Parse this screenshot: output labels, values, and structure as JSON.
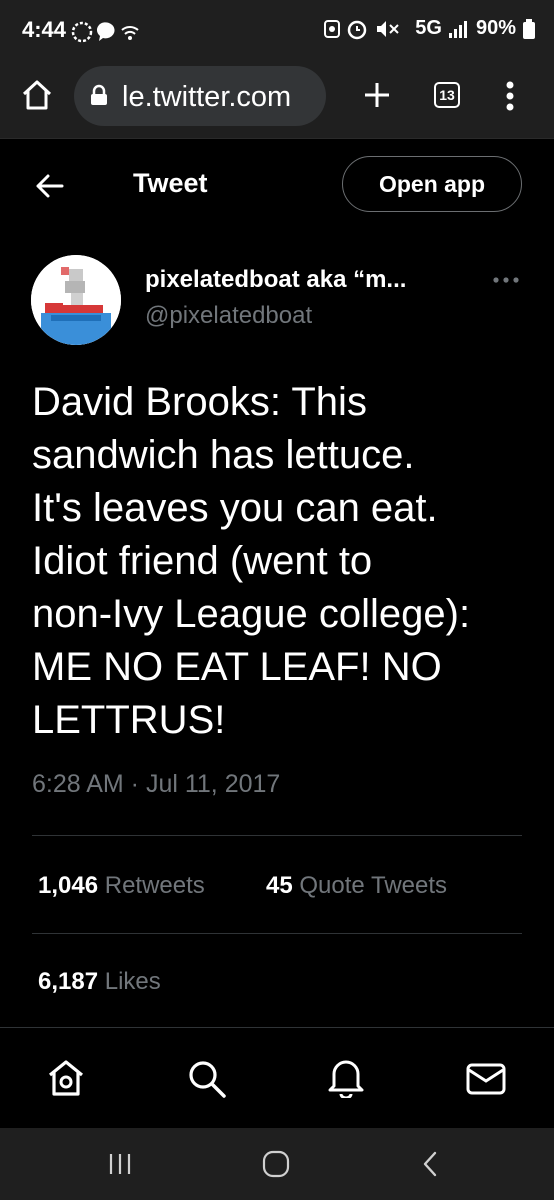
{
  "status_bar": {
    "time": "4:44",
    "network": "5G",
    "battery": "90%"
  },
  "browser": {
    "url": "le.twitter.com",
    "tab_count": "13"
  },
  "header": {
    "title": "Tweet",
    "open_app_label": "Open app"
  },
  "tweet": {
    "display_name": "pixelatedboat aka “m...",
    "handle": "@pixelatedboat",
    "text": "David Brooks: This\nsandwich has lettuce.\nIt's leaves you can eat.\nIdiot friend (went to\nnon-Ivy League college):\nME NO EAT LEAF! NO\nLETTRUS!",
    "timestamp": "6:28 AM · Jul 11, 2017",
    "retweets_count": "1,046",
    "retweets_label": "Retweets",
    "quotes_count": "45",
    "quotes_label": "Quote Tweets",
    "likes_count": "6,187",
    "likes_label": "Likes"
  },
  "bottom_nav": {
    "items": [
      "home-icon",
      "search-icon",
      "notifications-icon",
      "messages-icon"
    ]
  },
  "colors": {
    "background": "#000000",
    "chrome": "#1f1f1f",
    "text_primary": "#ffffff",
    "text_secondary": "#71767b",
    "divider": "#2f3336"
  }
}
